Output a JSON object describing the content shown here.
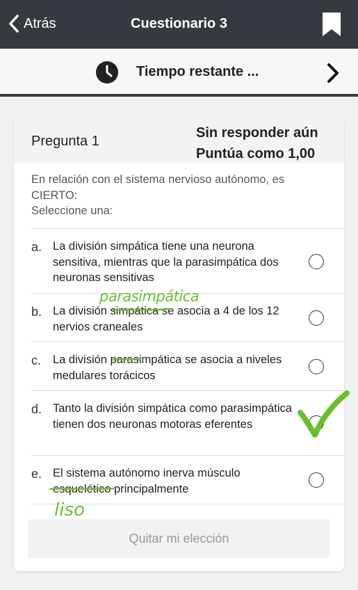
{
  "header": {
    "back_label": "Atrás",
    "title": "Cuestionario 3"
  },
  "timer": {
    "label": "Tiempo restante ..."
  },
  "question": {
    "number_label": "Pregunta 1",
    "status": "Sin responder aún",
    "score": "Puntúa como 1,00",
    "text": "En relación con el sistema nervioso autónomo, es CIERTO:",
    "select_prompt": "Seleccione una:",
    "options": [
      {
        "letter": "a.",
        "text": "La división simpática tiene una neurona sensitiva, mientras que la parasimpática dos neuronas sensitivas"
      },
      {
        "letter": "b.",
        "text": "La división simpática se asocia a 4 de los 12 nervios craneales"
      },
      {
        "letter": "c.",
        "text": "La división parasimpática se asocia a niveles medulares torácicos"
      },
      {
        "letter": "d.",
        "text": "Tanto la división simpática como parasimpática tienen dos neuronas motoras eferentes"
      },
      {
        "letter": "e.",
        "text": "El sistema autónomo inerva músculo esquelético principalmente"
      }
    ],
    "clear_label": "Quitar mi elección"
  },
  "annotations": {
    "ink_color": "#6abf2f",
    "b_correction": "parasimpática",
    "e_correction": "liso"
  },
  "icons": {
    "back": "chevron-left-icon",
    "bookmark": "bookmark-icon",
    "clock": "clock-icon",
    "next": "chevron-right-icon",
    "checkmark": "checkmark-icon"
  }
}
